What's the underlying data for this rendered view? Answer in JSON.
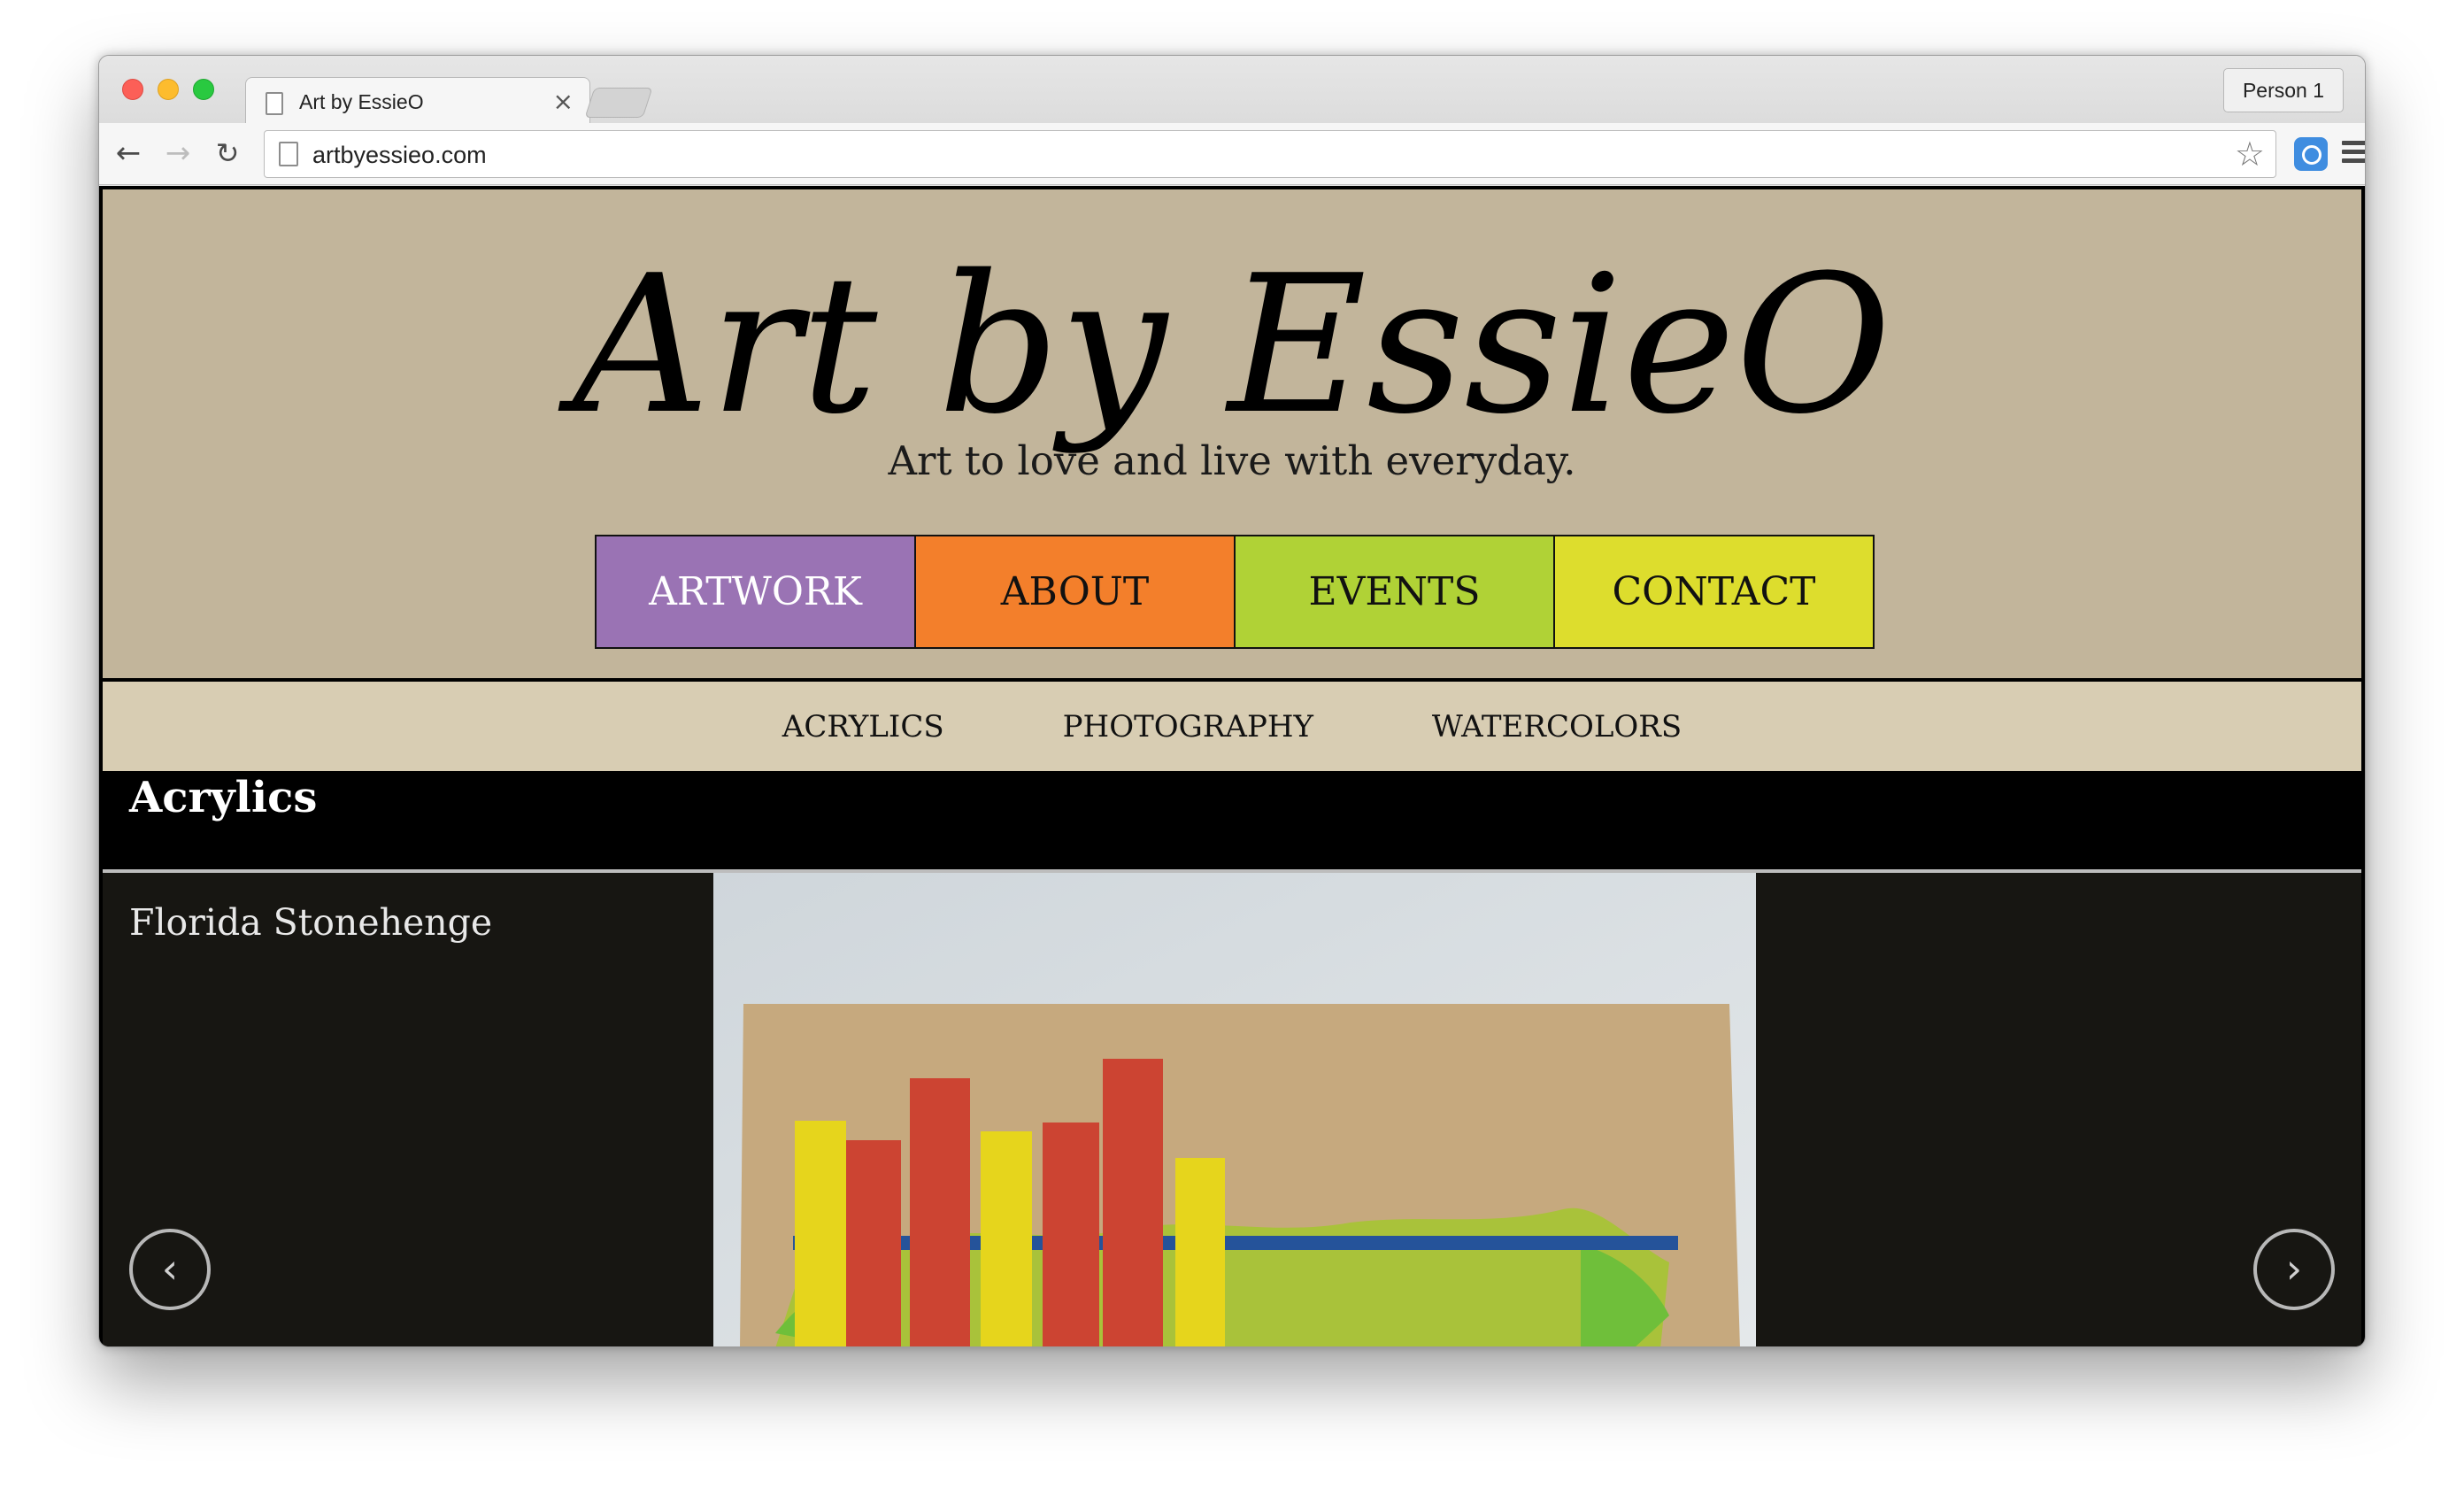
{
  "browser": {
    "tab_title": "Art by EssieO",
    "tab_close": "×",
    "profile_label": "Person 1",
    "url": "artbyessieo.com",
    "icons": [
      "page-icon",
      "back-arrow-icon",
      "forward-arrow-icon",
      "reload-icon",
      "bookmark-star-icon",
      "extension-icon",
      "menu-icon"
    ]
  },
  "site": {
    "logo_text": "Art by EssieO",
    "tagline": "Art to love and live with everyday.",
    "main_nav": [
      {
        "label": "ARTWORK",
        "color": "#9a73b4",
        "text_color": "#ffffff"
      },
      {
        "label": "ABOUT",
        "color": "#f37f2b",
        "text_color": "#111111"
      },
      {
        "label": "EVENTS",
        "color": "#b0d236",
        "text_color": "#111111"
      },
      {
        "label": "CONTACT",
        "color": "#dddd2d",
        "text_color": "#111111"
      }
    ],
    "sub_nav": [
      "ACRYLICS",
      "PHOTOGRAPHY",
      "WATERCOLORS"
    ],
    "section_title": "Acrylics",
    "artwork": {
      "title": "Florida Stonehenge"
    },
    "carousel": {
      "prev": "‹",
      "next": "›"
    },
    "colors": {
      "header_bg": "#c2b59b",
      "subnav_bg": "#d8cdb3",
      "gallery_bg": "#171612"
    }
  }
}
